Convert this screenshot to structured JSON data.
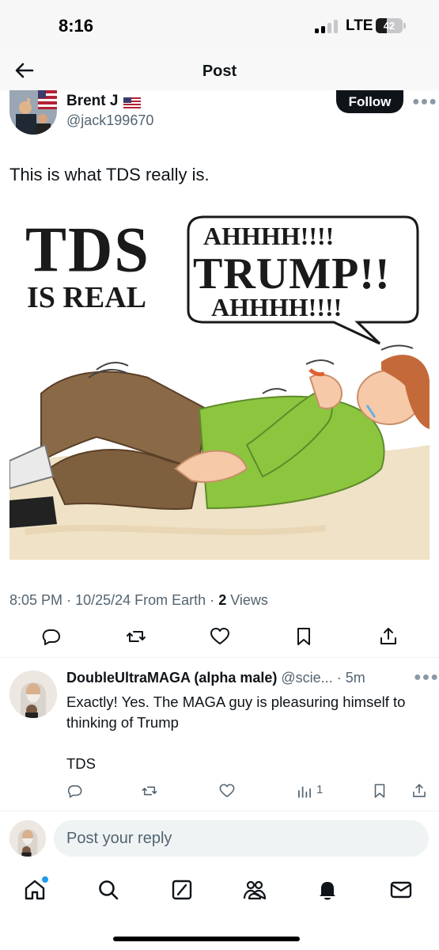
{
  "status_bar": {
    "time": "8:16",
    "network": "LTE",
    "battery": "42",
    "battery_level": 0.42
  },
  "header": {
    "title": "Post",
    "back_icon": "arrow-left-icon"
  },
  "tweet": {
    "author_name": "Brent J",
    "author_flag": "us-flag-icon",
    "author_handle": "@jack199670",
    "follow_label": "Follow",
    "more_icon": "more-icon",
    "text": "This is what TDS really is.",
    "image": {
      "line1": "TDS",
      "line2": "IS REAL",
      "bubble_line1": "AHHHH!!!!",
      "bubble_line2": "TRUMP!!",
      "bubble_line3": "AHHHH!!!!"
    },
    "meta": {
      "time": "8:05 PM",
      "date": "10/25/24",
      "source": "From Earth",
      "views_count": "2",
      "views_label": "Views"
    },
    "actions": [
      "reply-icon",
      "retweet-icon",
      "like-icon",
      "bookmark-icon",
      "share-icon"
    ]
  },
  "reply": {
    "name": "DoubleUltraMAGA (alpha male)",
    "handle": "@scie...",
    "time": "5m",
    "text": "Exactly! Yes. The MAGA guy is pleasuring himself to  thinking of Trump\n\nTDS",
    "views": "1",
    "actions": [
      "reply-icon",
      "retweet-icon",
      "like-icon",
      "views-icon",
      "bookmark-icon",
      "share-icon"
    ]
  },
  "compose": {
    "placeholder": "Post your reply"
  },
  "tabbar": [
    "home-icon",
    "search-icon",
    "grok-icon",
    "communities-icon",
    "notifications-icon",
    "messages-icon"
  ],
  "colors": {
    "text": "#0f1419",
    "secondary": "#536471",
    "accent": "#1d9bf0",
    "follow_bg": "#0f1419"
  }
}
